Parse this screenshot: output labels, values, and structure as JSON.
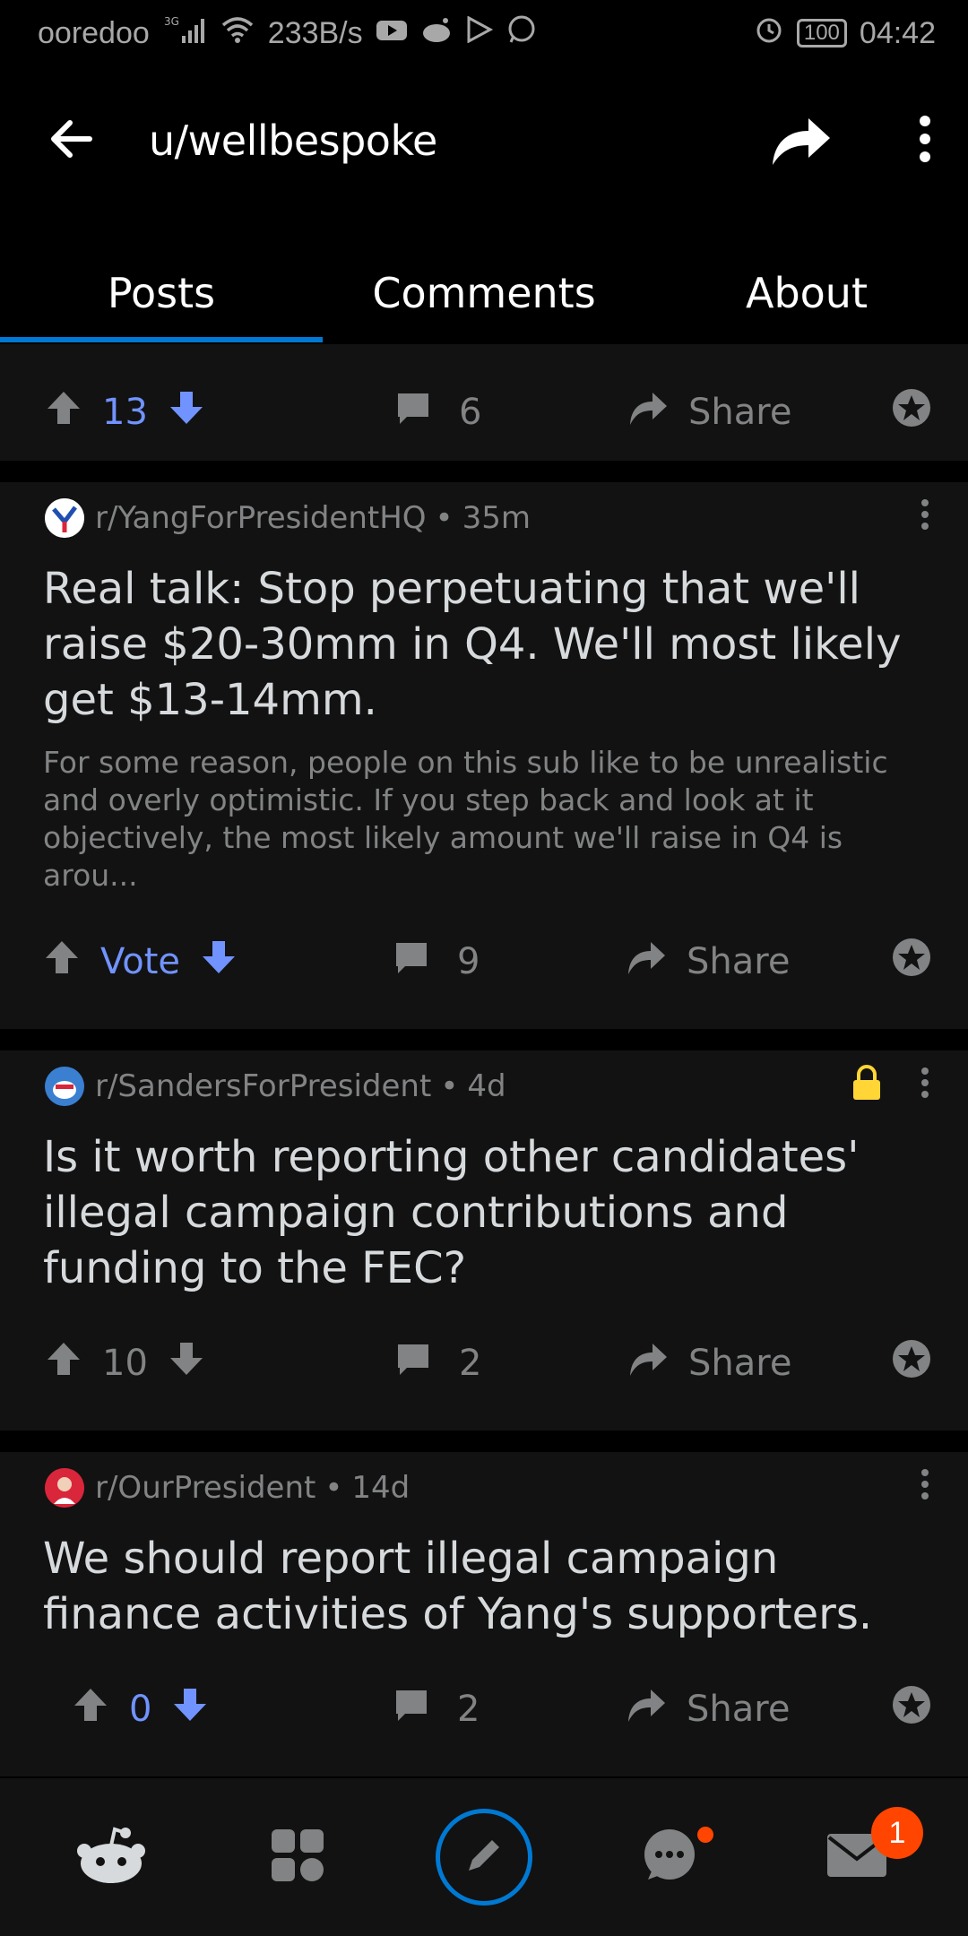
{
  "status_bar": {
    "carrier": "ooredoo",
    "network": "3G",
    "speed": "233B/s",
    "battery": "100",
    "time": "04:42"
  },
  "app_bar": {
    "title": "u/wellbespoke"
  },
  "tabs": [
    {
      "label": "Posts",
      "active": true
    },
    {
      "label": "Comments",
      "active": false
    },
    {
      "label": "About",
      "active": false
    }
  ],
  "posts": [
    {
      "vote_count": "13",
      "vote_active": true,
      "comments": "6",
      "share_label": "Share"
    },
    {
      "subreddit": "r/YangForPresidentHQ",
      "age": "35m",
      "title": "Real talk: Stop perpetuating that we'll raise $20-30mm in Q4. We'll most likely get $13-14mm.",
      "body": "For some reason, people on this sub like to be unrealistic and overly optimistic. If you step back and look at it objectively, the most likely amount we'll raise in Q4 is arou...",
      "vote_count": "Vote",
      "vote_active": true,
      "comments": "9",
      "share_label": "Share"
    },
    {
      "subreddit": "r/SandersForPresident",
      "age": "4d",
      "locked": true,
      "title": "Is it worth reporting other candidates' illegal campaign contributions and funding to the FEC?",
      "vote_count": "10",
      "vote_active": false,
      "comments": "2",
      "share_label": "Share"
    },
    {
      "subreddit": "r/OurPresident",
      "age": "14d",
      "title": "We should report illegal campaign finance activities of Yang's supporters.",
      "vote_count": "0",
      "vote_active": true,
      "comments": "2",
      "share_label": "Share"
    }
  ],
  "bottom_nav": {
    "inbox_badge": "1"
  },
  "colors": {
    "accent": "#0079d3",
    "upvote_blue": "#7193ff",
    "notification": "#ff4500",
    "lock": "#ffd635"
  }
}
